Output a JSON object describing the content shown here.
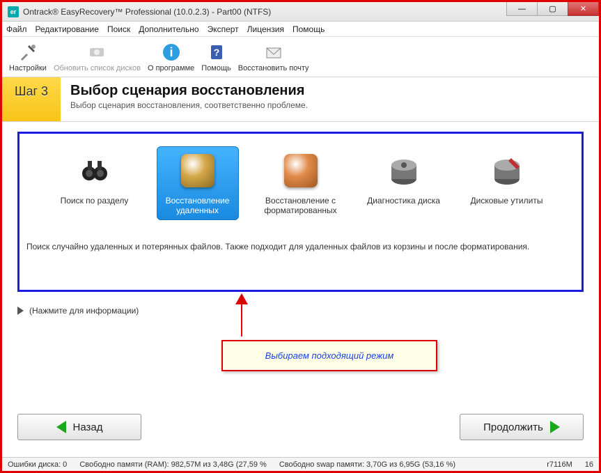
{
  "title": "Ontrack® EasyRecovery™ Professional (10.0.2.3) - Part00 (NTFS)",
  "menu": [
    "Файл",
    "Редактирование",
    "Поиск",
    "Дополнительно",
    "Эксперт",
    "Лицензия",
    "Помощь"
  ],
  "toolbar": [
    {
      "label": "Настройки",
      "icon": "tools-icon",
      "enabled": true
    },
    {
      "label": "Обновить список дисков",
      "icon": "refresh-icon",
      "enabled": false
    },
    {
      "label": "О программе",
      "icon": "info-icon",
      "enabled": true
    },
    {
      "label": "Помощь",
      "icon": "help-book-icon",
      "enabled": true
    },
    {
      "label": "Восстановить почту",
      "icon": "mail-icon",
      "enabled": true
    }
  ],
  "step": {
    "label": "Шаг 3",
    "title": "Выбор сценария восстановления",
    "subtitle": "Выбор сценария восстановления, соответственно проблеме."
  },
  "scenarios": [
    {
      "label": "Поиск по разделу",
      "icon": "binoculars-icon",
      "selected": false
    },
    {
      "label": "Восстановление удаленных",
      "icon": "recycle-icon",
      "selected": true
    },
    {
      "label": "Восстановление с форматированных",
      "icon": "format-icon",
      "selected": false
    },
    {
      "label": "Диагностика диска",
      "icon": "disk-diag-icon",
      "selected": false
    },
    {
      "label": "Дисковые утилиты",
      "icon": "disk-tools-icon",
      "selected": false
    }
  ],
  "scenario_desc": "Поиск случайно удаленных и потерянных файлов. Также подходит для удаленных файлов из корзины и после форматирования.",
  "hint": "(Нажмите для информации)",
  "callout": "Выбираем подходящий режим",
  "nav": {
    "back": "Назад",
    "next": "Продолжить"
  },
  "status": {
    "errors": "Ошибки диска: 0",
    "ram": "Свободно памяти (RAM): 982,57M из 3,48G (27,59 %",
    "swap": "Свободно swap памяти: 3,70G из 6,95G (53,16 %)",
    "code": "r7116M",
    "num": "16"
  }
}
